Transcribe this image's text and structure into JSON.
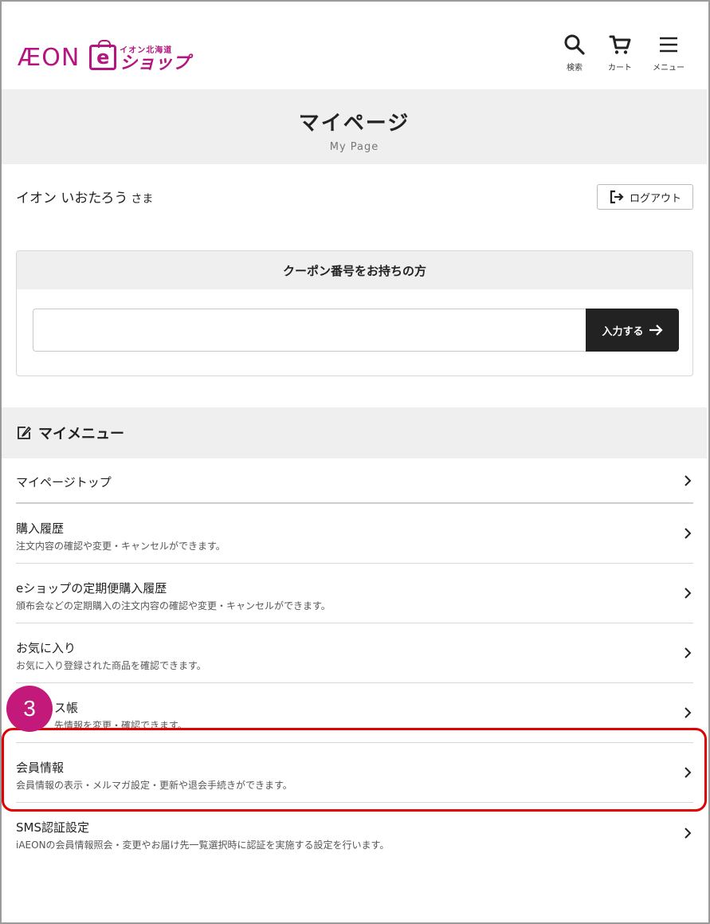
{
  "header": {
    "logo_brand": "ÆON",
    "logo_small_text": "イオン北海道",
    "logo_e": "e",
    "logo_shop_text": "ショップ",
    "search_label": "検索",
    "cart_label": "カート",
    "menu_label": "メニュー"
  },
  "page": {
    "title": "マイページ",
    "subtitle": "My Page"
  },
  "user": {
    "name": "イオン いおたろう",
    "honorific": "さま",
    "logout_label": "ログアウト"
  },
  "coupon": {
    "heading": "クーポン番号をお持ちの方",
    "input_value": "",
    "input_placeholder": "",
    "submit_label": "入力する"
  },
  "my_menu": {
    "heading": "マイメニュー",
    "items": [
      {
        "title": "マイページトップ",
        "desc": ""
      },
      {
        "title": "購入履歴",
        "desc": "注文内容の確認や変更・キャンセルができます。"
      },
      {
        "title": "eショップの定期便購入履歴",
        "desc": "頒布会などの定期購入の注文内容の確認や変更・キャンセルができます。"
      },
      {
        "title": "お気に入り",
        "desc": "お気に入り登録された商品を確認できます。"
      },
      {
        "title": "ス帳",
        "desc": "先情報を変更・確認できます。"
      },
      {
        "title": "会員情報",
        "desc": "会員情報の表示・メルマガ設定・更新や退会手続きができます。"
      },
      {
        "title": "SMS認証設定",
        "desc": "iAEONの会員情報照会・変更やお届け先一覧選択時に認証を実施する設定を行います。"
      }
    ]
  },
  "annotation": {
    "step_number": "3"
  },
  "colors": {
    "brand": "#b4157e",
    "step_circle": "#c2197a",
    "highlight": "#e00000",
    "band_gray": "#efefef",
    "button_dark": "#222222"
  }
}
